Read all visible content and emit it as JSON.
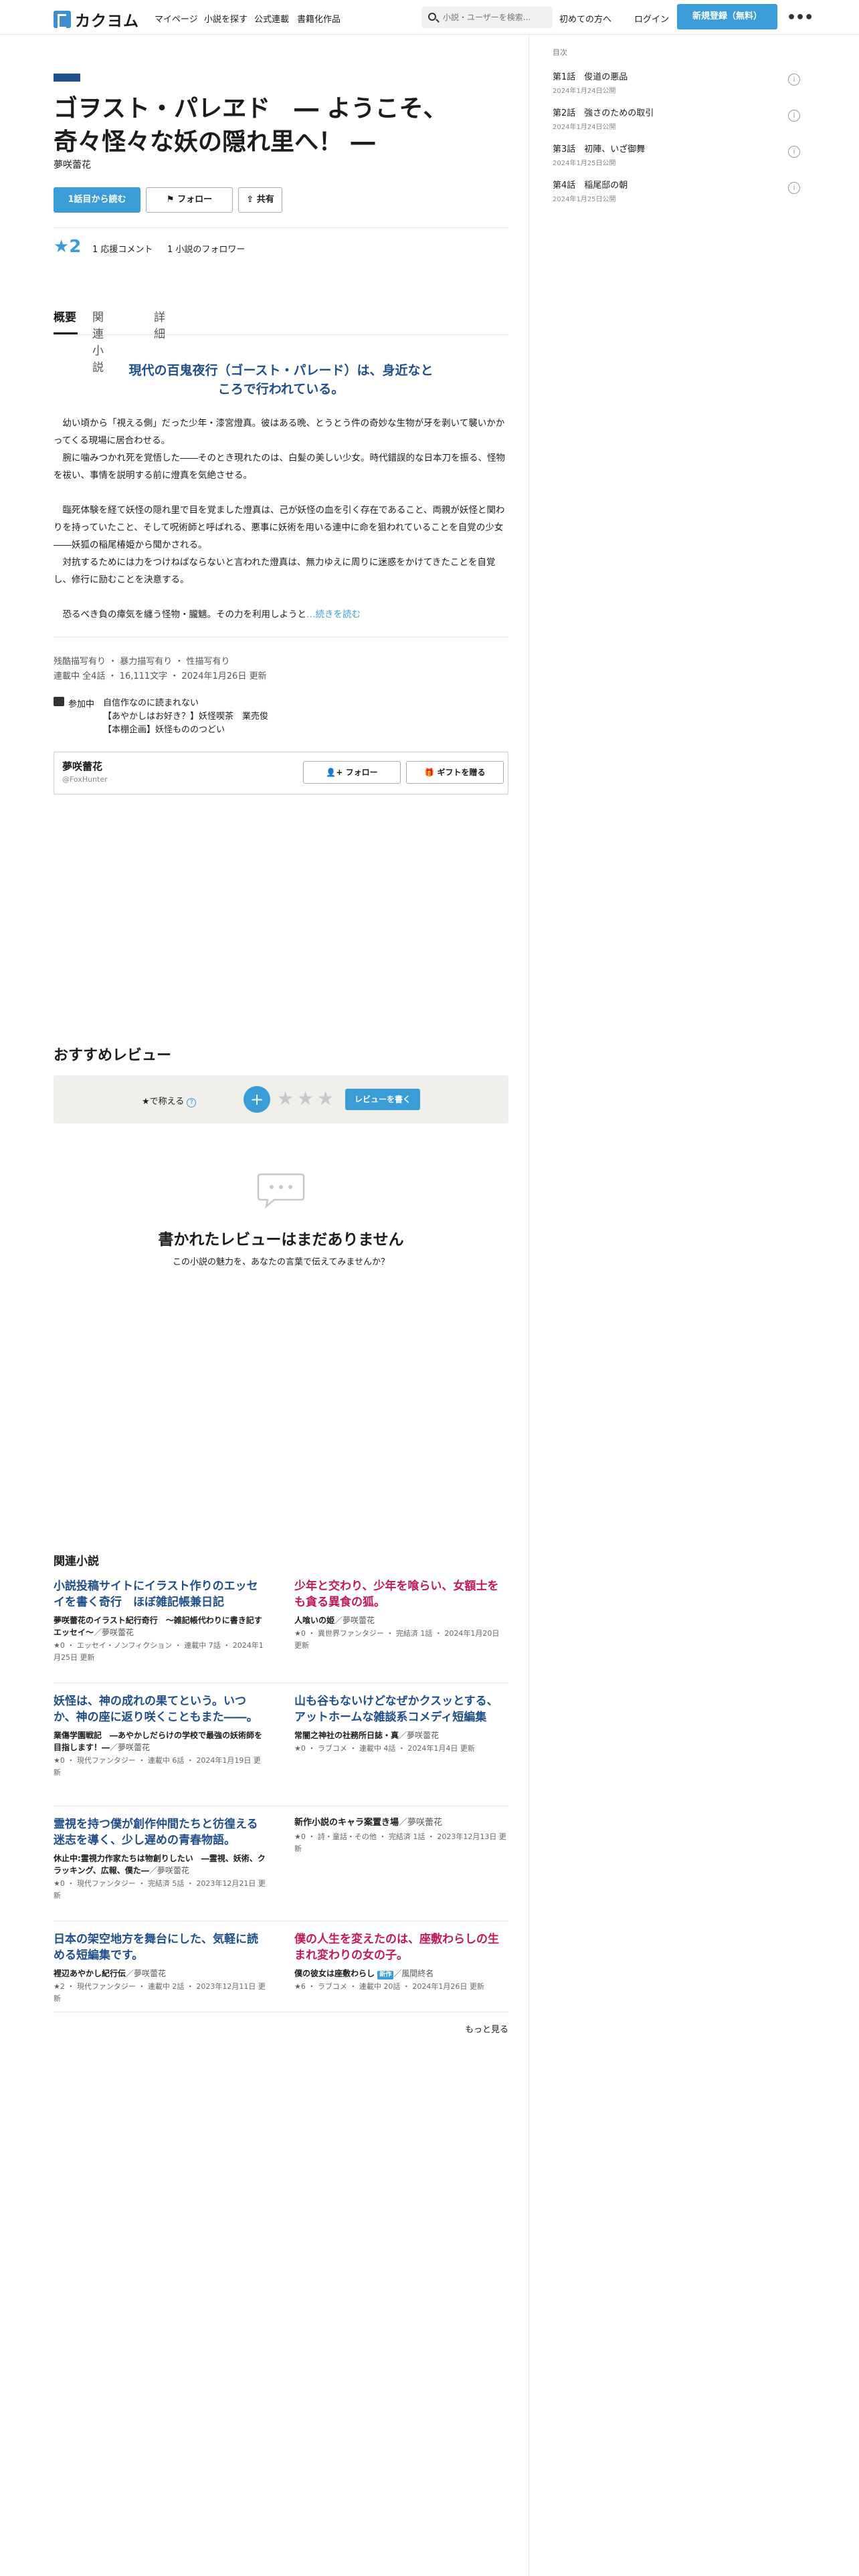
{
  "header": {
    "logo_text": "カクヨム",
    "nav": [
      "マイページ",
      "小説を探す",
      "公式連載",
      "書籍化作品"
    ],
    "search_placeholder": "小説・ユーザーを検索...",
    "beginner": "初めての方へ",
    "login": "ログイン",
    "signup": "新規登録（無料）",
    "more": "•••"
  },
  "work": {
    "title": "ゴヲスト・パレヱド　― ようこそ、奇々怪々な妖の隠れ里へ！ ―",
    "author": "夢咲蕾花",
    "read_button": "1話目から読む",
    "follow_button": "フォロー",
    "share_button": "共有",
    "stars": "★2",
    "review_count": "1 応援コメント",
    "follower_count": "1 小説のフォロワー"
  },
  "tabs": [
    "概要",
    "関連小説",
    "詳細"
  ],
  "overview": {
    "catch": "現代の百鬼夜行（ゴースト・パレード）は、身近なところで行われている。",
    "intro": "　幼い頃から「視える側」だった少年・漆宮燈真。彼はある晩、とうとう件の奇妙な生物が牙を剥いて襲いかかってくる現場に居合わせる。\n　腕に噛みつかれ死を覚悟した――そのとき現れたのは、白髪の美しい少女。時代錯誤的な日本刀を振る、怪物を祓い、事情を説明する前に燈真を気絶させる。\n\n　臨死体験を経て妖怪の隠れ里で目を覚ました燈真は、己が妖怪の血を引く存在であること、両親が妖怪と関わりを持っていたこと、そして呪術師と呼ばれる、悪事に妖術を用いる連中に命を狙われていることを自覚の少女――妖狐の稲尾椿姫から聞かされる。\n　対抗するためには力をつけねばならないと言われた燈真は、無力ゆえに周りに迷惑をかけてきたことを自覚し、修行に励むことを決意する。\n\n　恐るべき負の瘴気を纏う怪物・朧魑。その力を利用しようと",
    "read_more": "…続きを読む",
    "tags": "残酷描写有り ・ 暴力描写有り ・ 性描写有り",
    "meta": "連載中 全4話 ・ 16,111文字 ・ 2024年1月26日 更新",
    "event_label": "参加中",
    "events": [
      "自信作なのに読まれない",
      "【あやかしはお好き？】妖怪喫茶　業売俊",
      "【本棚企画】妖怪もののつどい"
    ]
  },
  "author_card": {
    "name": "夢咲蕾花",
    "id": "@FoxHunter",
    "follow": "フォロー",
    "gift": "ギフトを贈る"
  },
  "reviews": {
    "heading": "おすすめレビュー",
    "prompt": "★で称える",
    "help": "?",
    "plus": "+",
    "write": "レビューを書く",
    "empty_title": "書かれたレビューはまだありません",
    "empty_sub": "この小説の魅力を、あなたの言葉で伝えてみませんか？"
  },
  "related": {
    "heading": "関連小説",
    "items": [
      {
        "title": "小説投稿サイトにイラスト作りのエッセイを書く奇行　ほぼ雑記帳兼日記",
        "sub": "夢咲蕾花のイラスト紀行奇行　～雑記帳代わりに書き記すエッセイ～",
        "by": "／夢咲蕾花",
        "meta": "★0 ・ エッセイ・ノンフィクション ・ 連載中 7話 ・ 2024年1月25日 更新"
      },
      {
        "title": "少年と交わり、少年を喰らい、女額士をも貪る異食の狐。",
        "sub": "人喰いの姫",
        "by": "／夢咲蕾花",
        "meta": "★0 ・ 異世界ファンタジー ・ 完結済 1話 ・ 2024年1月20日 更新"
      },
      {
        "title": "妖怪は、神の成れの果てという。いつか、神の座に返り咲くこともまた――。",
        "sub": "業傷学園戦記　―あやかしだらけの学校で最強の妖術師を目指します！―",
        "by": "／夢咲蕾花",
        "meta": "★0 ・ 現代ファンタジー ・ 連載中 6話 ・ 2024年1月19日 更新"
      },
      {
        "title": "山も谷もないけどなぜかクスッとする、アットホームな雑談系コメディ短編集",
        "sub": "常闇之神社の社務所日誌・真",
        "by": "／夢咲蕾花",
        "meta": "★0 ・ ラブコメ ・ 連載中 4話 ・ 2024年1月4日 更新"
      },
      {
        "title": "霊視を持つ僕が創作仲間たちと彷徨える迷志を導く、少し遅めの青春物語。",
        "sub": "休止中:霊視力作家たちは物創りしたい　―霊視、妖術、クラッキング、広報、僕た―",
        "by": "／夢咲蕾花",
        "meta": "★0 ・ 現代ファンタジー ・ 完結済 5話 ・ 2023年12月21日 更新"
      },
      {
        "title": "新作小説のキャラ案置き場",
        "sub": "",
        "by": "／夢咲蕾花",
        "meta": "★0 ・ 詩・童話・その他 ・ 完結済 1話 ・ 2023年12月13日 更新"
      },
      {
        "title": "日本の架空地方を舞台にした、気軽に読める短編集です。",
        "sub": "裡辺あやかし紀行伝",
        "by": "／夢咲蕾花",
        "meta": "★2 ・ 現代ファンタジー ・ 連載中 2話 ・ 2023年12月11日 更新"
      },
      {
        "title": "僕の人生を変えたのは、座敷わらしの生まれ変わりの女の子。",
        "sub": "僕の彼女は座敷わらし",
        "badge": "新作",
        "by": "／風間終名",
        "meta": "★6 ・ ラブコメ ・ 連載中 20話 ・ 2024年1月26日 更新"
      }
    ],
    "more": "もっと見る"
  },
  "toc": {
    "label": "目次",
    "items": [
      {
        "title": "第1話　俊道の悪品",
        "date": "2024年1月24日公開"
      },
      {
        "title": "第2話　強さのための取引",
        "date": "2024年1月24日公開"
      },
      {
        "title": "第3話　初陣、いざ御舞",
        "date": "2024年1月25日公開"
      },
      {
        "title": "第4話　稲尾邸の朝",
        "date": "2024年1月25日公開"
      }
    ],
    "info": "i"
  },
  "colors": {
    "accent": "#3b9dd8",
    "navy": "#1f4f8a",
    "pink": "#c2185b"
  }
}
